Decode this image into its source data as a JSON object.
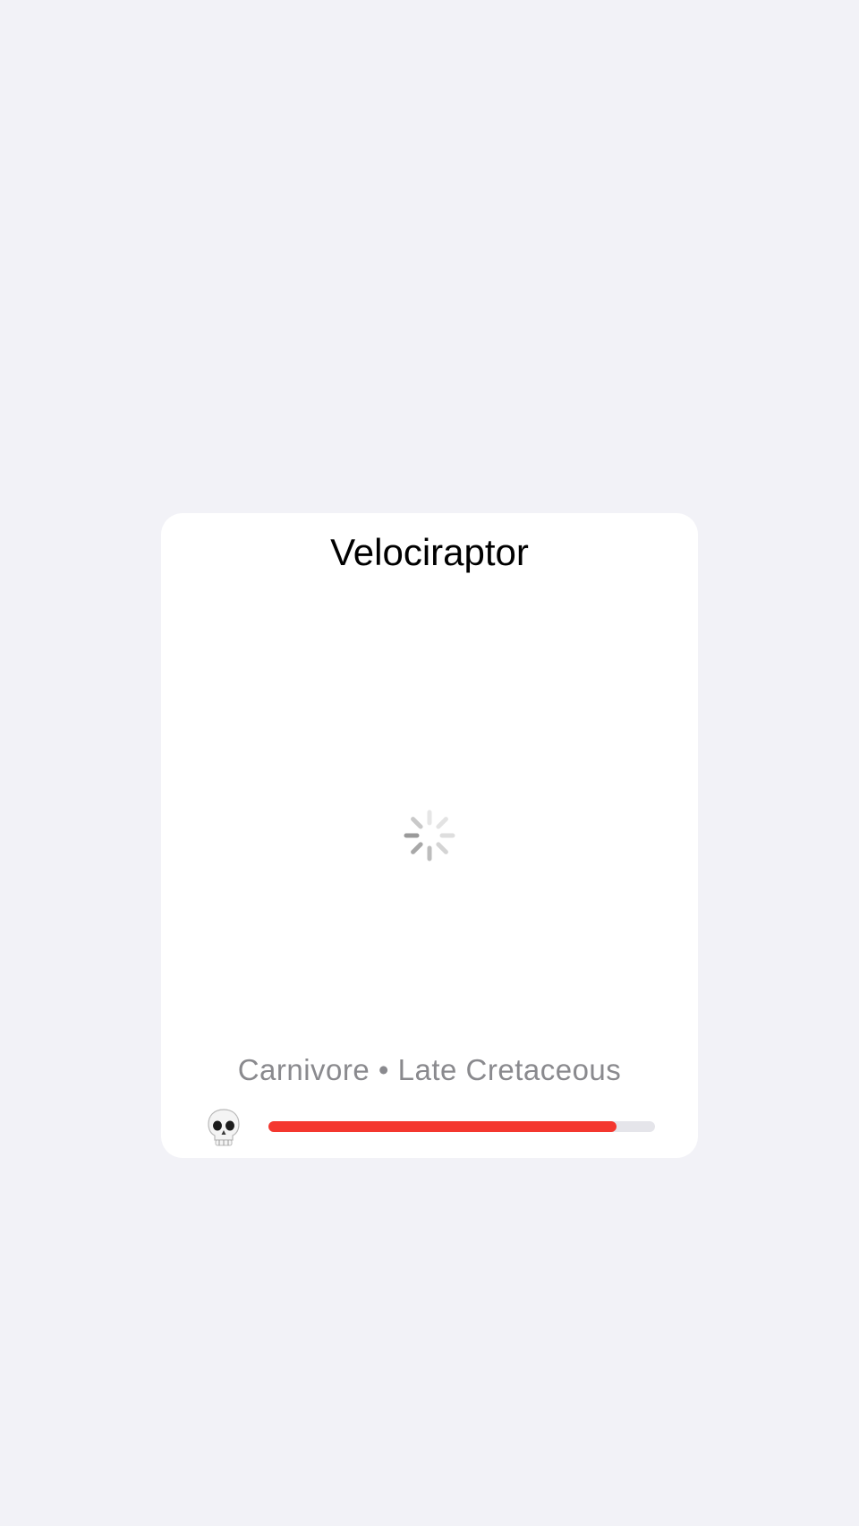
{
  "card": {
    "title": "Velociraptor",
    "loading_icon": "activity-spinner-icon",
    "subtitle": "Carnivore • Late Cretaceous",
    "threat": {
      "icon": "skull-icon",
      "level_fraction": 0.9,
      "fill_color": "#f4372f",
      "track_color": "#e5e5ea"
    }
  }
}
